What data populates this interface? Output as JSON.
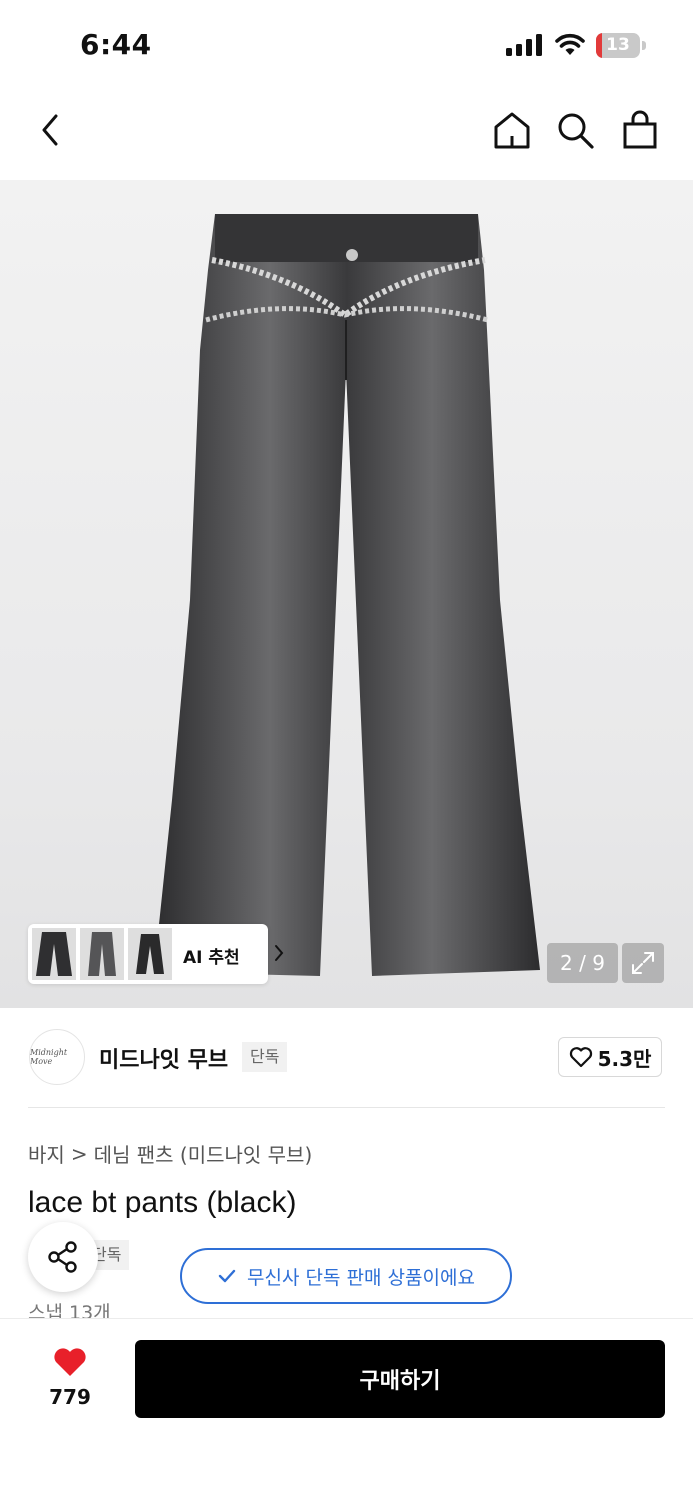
{
  "status_bar": {
    "time": "6:44",
    "battery": "13",
    "battery_level": 0.13
  },
  "colors": {
    "accent_blue": "#2e6fd6",
    "heart_red": "#e8202a",
    "buy_bg": "#000000"
  },
  "product": {
    "page_counter": "2 / 9",
    "ai_recommend_label": "AI 추천"
  },
  "brand": {
    "name": "미드나잇 무브",
    "badge": "단독",
    "likes": "5.3만",
    "logo_text": "Midnight Move"
  },
  "breadcrumb": {
    "category": "바지",
    "separator": ">",
    "subcategory": "데님 팬츠 (미드나잇 무브)"
  },
  "title": "lace bt pants (black)",
  "exclusive_tag": "단독",
  "snap_count": "스냅 13개",
  "toast": {
    "text": "무신사 단독 판매 상품이에요"
  },
  "bottom": {
    "wish_count": "779",
    "buy_label": "구매하기"
  }
}
